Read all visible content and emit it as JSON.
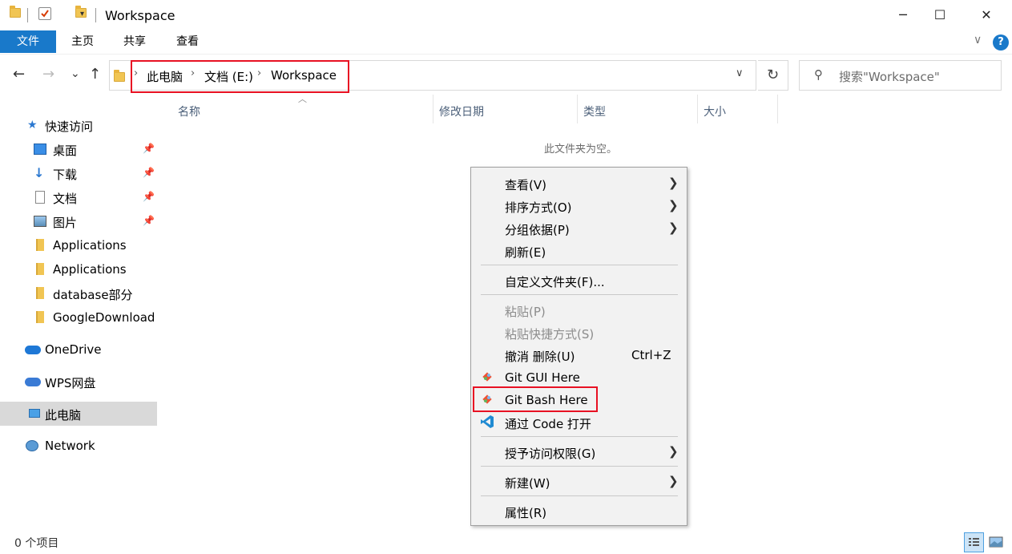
{
  "window": {
    "title": "Workspace",
    "controls": {
      "minimize": "─",
      "maximize": "☐",
      "close": "✕"
    }
  },
  "ribbon": {
    "tabs": [
      "文件",
      "主页",
      "共享",
      "查看"
    ],
    "help": "?"
  },
  "nav": {
    "back": "←",
    "forward": "→",
    "recent": "⌄",
    "up": "↑"
  },
  "address": {
    "crumbs": [
      "此电脑",
      "文档 (E:)",
      "Workspace"
    ],
    "separator": "›"
  },
  "search": {
    "placeholder": "搜索\"Workspace\""
  },
  "sidebar": {
    "items": [
      {
        "label": "快速访问",
        "icon": "star-icon"
      },
      {
        "label": "桌面",
        "icon": "desktop-icon",
        "pinned": true
      },
      {
        "label": "下载",
        "icon": "download-icon",
        "pinned": true
      },
      {
        "label": "文档",
        "icon": "document-icon",
        "pinned": true
      },
      {
        "label": "图片",
        "icon": "pictures-icon",
        "pinned": true
      },
      {
        "label": "Applications",
        "icon": "folder-icon"
      },
      {
        "label": "Applications",
        "icon": "folder-icon"
      },
      {
        "label": "database部分",
        "icon": "folder-icon"
      },
      {
        "label": "GoogleDownload",
        "icon": "folder-icon"
      },
      {
        "label": "OneDrive",
        "icon": "cloud-icon"
      },
      {
        "label": "WPS网盘",
        "icon": "cloud-icon"
      },
      {
        "label": "此电脑",
        "icon": "computer-icon",
        "selected": true
      },
      {
        "label": "Network",
        "icon": "network-icon"
      }
    ]
  },
  "columns": [
    "名称",
    "修改日期",
    "类型",
    "大小"
  ],
  "empty_message": "此文件夹为空。",
  "context_menu": {
    "items": [
      {
        "label": "查看(V)",
        "submenu": true
      },
      {
        "label": "排序方式(O)",
        "submenu": true
      },
      {
        "label": "分组依据(P)",
        "submenu": true
      },
      {
        "label": "刷新(E)"
      },
      {
        "label": "自定义文件夹(F)..."
      },
      {
        "label": "粘贴(P)",
        "disabled": true
      },
      {
        "label": "粘贴快捷方式(S)",
        "disabled": true
      },
      {
        "label": "撤消 删除(U)",
        "shortcut": "Ctrl+Z"
      },
      {
        "label": "Git GUI Here",
        "icon": "git-icon"
      },
      {
        "label": "Git Bash Here",
        "icon": "git-icon"
      },
      {
        "label": "通过 Code 打开",
        "icon": "vscode-icon"
      },
      {
        "label": "授予访问权限(G)",
        "submenu": true
      },
      {
        "label": "新建(W)",
        "submenu": true
      },
      {
        "label": "属性(R)"
      }
    ]
  },
  "status": {
    "text": "0 个项目"
  },
  "colors": {
    "accent": "#1979ca",
    "highlight": "#e81123",
    "menu_bg": "#f2f2f2"
  }
}
